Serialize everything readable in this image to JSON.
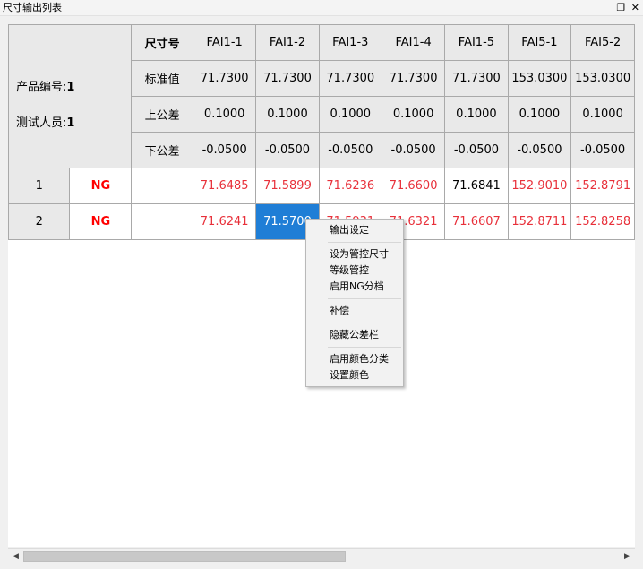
{
  "window": {
    "title": "尺寸输出列表",
    "restore_icon": "restore-icon",
    "close_icon": "close-icon"
  },
  "info": {
    "product_no_label": "产品编号:",
    "product_no": "1",
    "tester_label": "测试人员:",
    "tester": "1"
  },
  "header_rows": {
    "dimension_label": "尺寸号",
    "nominal_label": "标准值",
    "upper_label": "上公差",
    "lower_label": "下公差"
  },
  "columns": [
    {
      "name": "FAI1-1",
      "nominal": "71.7300",
      "upper": "0.1000",
      "lower": "-0.0500"
    },
    {
      "name": "FAI1-2",
      "nominal": "71.7300",
      "upper": "0.1000",
      "lower": "-0.0500"
    },
    {
      "name": "FAI1-3",
      "nominal": "71.7300",
      "upper": "0.1000",
      "lower": "-0.0500"
    },
    {
      "name": "FAI1-4",
      "nominal": "71.7300",
      "upper": "0.1000",
      "lower": "-0.0500"
    },
    {
      "name": "FAI1-5",
      "nominal": "71.7300",
      "upper": "0.1000",
      "lower": "-0.0500"
    },
    {
      "name": "FAI5-1",
      "nominal": "153.0300",
      "upper": "0.1000",
      "lower": "-0.0500"
    },
    {
      "name": "FAI5-2",
      "nominal": "153.0300",
      "upper": "0.1000",
      "lower": "-0.0500"
    }
  ],
  "rows": [
    {
      "index": "1",
      "result": "NG",
      "values": [
        {
          "v": "71.6485",
          "color": "red"
        },
        {
          "v": "71.5899",
          "color": "red"
        },
        {
          "v": "71.6236",
          "color": "red"
        },
        {
          "v": "71.6600",
          "color": "red"
        },
        {
          "v": "71.6841",
          "color": "black"
        },
        {
          "v": "152.9010",
          "color": "red"
        },
        {
          "v": "152.8791",
          "color": "red"
        }
      ]
    },
    {
      "index": "2",
      "result": "NG",
      "values": [
        {
          "v": "71.6241",
          "color": "red"
        },
        {
          "v": "71.5700",
          "color": "selected"
        },
        {
          "v": "71.5931",
          "color": "red"
        },
        {
          "v": "71.6321",
          "color": "red"
        },
        {
          "v": "71.6607",
          "color": "red"
        },
        {
          "v": "152.8711",
          "color": "red"
        },
        {
          "v": "152.8258",
          "color": "red"
        }
      ]
    }
  ],
  "context_menu": {
    "groups": [
      [
        "输出设定"
      ],
      [
        "设为管控尺寸",
        "等级管控",
        "启用NG分档"
      ],
      [
        "补偿"
      ],
      [
        "隐藏公差栏"
      ],
      [
        "启用颜色分类",
        "设置颜色"
      ]
    ]
  },
  "colors": {
    "ng_red": "#ff0000",
    "out_of_tol": "#e8303a",
    "selection": "#1f7ed6",
    "header_bg": "#e9e9e9"
  }
}
